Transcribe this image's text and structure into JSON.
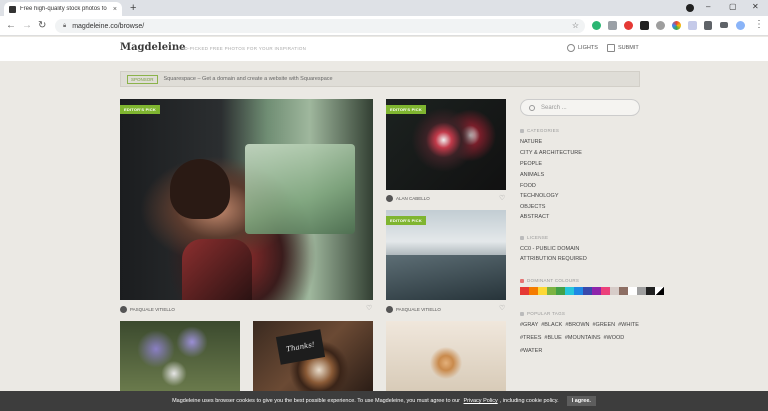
{
  "browser": {
    "tab_title": "Free high-quality stock photos fo",
    "tab_close": "×",
    "new_tab": "+",
    "url": "magdeleine.co/browse/",
    "window_controls": [
      "–",
      "▢",
      "✕"
    ]
  },
  "header": {
    "logo": "Magdeleine",
    "tagline": "HAND-PICKED FREE PHOTOS FOR YOUR INSPIRATION",
    "lights_label": "LIGHTS",
    "submit_label": "SUBMIT"
  },
  "sponsor": {
    "badge": "SPONSOR",
    "text": "Squarespace – Get a domain and create a website with Squarespace"
  },
  "photos": [
    {
      "pick": "EDITOR'S PICK",
      "credit": "PASQUALE VITIELLO"
    },
    {
      "pick": "EDITOR'S PICK",
      "credit": "ALAN CABELLO"
    },
    {
      "pick": "EDITOR'S PICK",
      "credit": "PASQUALE VITIELLO"
    }
  ],
  "sidebar": {
    "search_placeholder": "Search ...",
    "categories_title": "CATEGORIES",
    "categories": [
      "NATURE",
      "CITY & ARCHITECTURE",
      "PEOPLE",
      "ANIMALS",
      "FOOD",
      "TECHNOLOGY",
      "OBJECTS",
      "ABSTRACT"
    ],
    "license_title": "LICENSE",
    "licenses": [
      "CC0 - PUBLIC DOMAIN",
      "ATTRIBUTION REQUIRED"
    ],
    "colours_title": "DOMINANT COLOURS",
    "colours": [
      "#e53935",
      "#f57c00",
      "#fdd835",
      "#7cb342",
      "#43a047",
      "#26c6da",
      "#1e88e5",
      "#3949ab",
      "#8e24aa",
      "#ec407a",
      "#d7ccc8",
      "#8d6e63",
      "#ffffff",
      "#9e9e9e",
      "#212121"
    ],
    "tags_title": "POPULAR TAGS",
    "tags": [
      [
        "#GRAY",
        "#BLACK",
        "#BROWN",
        "#GREEN",
        "#WHITE"
      ],
      [
        "#TREES",
        "#BLUE",
        "#MOUNTAINS",
        "#WOOD"
      ],
      [
        "#WATER"
      ]
    ]
  },
  "cookie": {
    "text_before": "Magdeleine uses browser cookies to give you the best possible experience. To use Magdeleine, you must agree to our",
    "policy_link": "Privacy Policy",
    "text_after": ", including cookie policy.",
    "agree": "I agree."
  }
}
